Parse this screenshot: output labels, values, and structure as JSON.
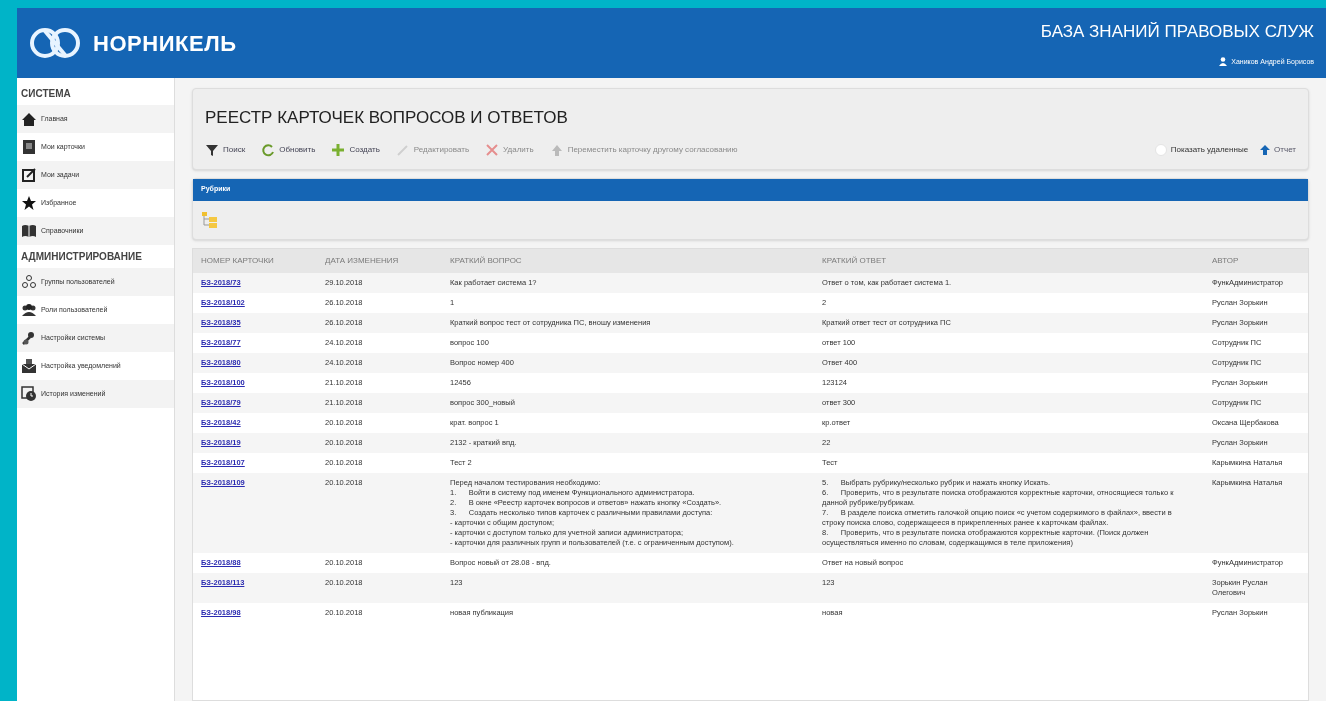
{
  "header": {
    "logo": "НОРНИКЕЛЬ",
    "title": "БАЗА ЗНАНИЙ ПРАВОВЫХ СЛУЖ",
    "user": "Хаников Андрей Борисов"
  },
  "sidebar": {
    "sections": [
      {
        "title": "СИСТЕМА",
        "items": [
          {
            "label": "Главная",
            "kind": "home"
          },
          {
            "label": "Мои карточки",
            "kind": "cards"
          },
          {
            "label": "Мои задачи",
            "kind": "tasks"
          },
          {
            "label": "Избранное",
            "kind": "star"
          },
          {
            "label": "Справочники",
            "kind": "book"
          }
        ]
      },
      {
        "title": "АДМИНИСТРИРОВАНИЕ",
        "items": [
          {
            "label": "Группы пользователей",
            "kind": "groups"
          },
          {
            "label": "Роли пользователей",
            "kind": "roles"
          },
          {
            "label": "Настройки системы",
            "kind": "settings"
          },
          {
            "label": "Настройка уведомлений",
            "kind": "notify"
          },
          {
            "label": "История изменений",
            "kind": "history"
          }
        ]
      }
    ]
  },
  "page_title": "РЕЕСТР КАРТОЧЕК ВОПРОСОВ И ОТВЕТОВ",
  "toolbar": [
    {
      "label": "Поиск",
      "kind": "filter",
      "disabled": false
    },
    {
      "label": "Обновить",
      "kind": "refresh",
      "disabled": false
    },
    {
      "label": "Создать",
      "kind": "plus",
      "disabled": false
    },
    {
      "label": "Редактировать",
      "kind": "edit",
      "disabled": true
    },
    {
      "label": "Удалить",
      "kind": "delete",
      "disabled": true
    },
    {
      "label": "Переместить карточку другому согласованию",
      "kind": "move",
      "disabled": true
    }
  ],
  "show_deleted": {
    "label": "Показать удаленные",
    "checked": false
  },
  "report": {
    "label": "Отчет"
  },
  "rubrics": {
    "title": "Рубрики"
  },
  "table": {
    "columns": [
      "НОМЕР КАРТОЧКИ",
      "ДАТА ИЗМЕНЕНИЯ",
      "КРАТКИЙ ВОПРОС",
      "КРАТКИЙ ОТВЕТ",
      "АВТОР"
    ],
    "rows": [
      [
        "БЗ-2018/73",
        "29.10.2018",
        "Как работает система 1?",
        "Ответ о том, как работает система 1.",
        "ФункАдминистратор"
      ],
      [
        "БЗ-2018/102",
        "26.10.2018",
        "1",
        "2",
        "Руслан Зорькин"
      ],
      [
        "БЗ-2018/35",
        "26.10.2018",
        "Краткий вопрос тест от сотрудника ПС, вношу изменения",
        "Краткий ответ тест от сотрудника ПС",
        "Руслан Зорькин"
      ],
      [
        "БЗ-2018/77",
        "24.10.2018",
        "вопрос 100",
        "ответ 100",
        "Сотрудник ПС"
      ],
      [
        "БЗ-2018/80",
        "24.10.2018",
        "Вопрос номер 400",
        "Ответ 400",
        "Сотрудник ПС"
      ],
      [
        "БЗ-2018/100",
        "21.10.2018",
        "12456",
        "123124",
        "Руслан Зорькин"
      ],
      [
        "БЗ-2018/79",
        "21.10.2018",
        "вопрос 300_новый",
        "ответ 300",
        "Сотрудник ПС"
      ],
      [
        "БЗ-2018/42",
        "20.10.2018",
        "крат. вопрос 1",
        "кр.ответ",
        "Оксана Щербакова"
      ],
      [
        "БЗ-2018/19",
        "20.10.2018",
        "2132 - краткий впд.",
        "22",
        "Руслан Зорькин"
      ],
      [
        "БЗ-2018/107",
        "20.10.2018",
        "Тест 2",
        "Тест",
        "Карымкина Наталья"
      ],
      [
        "БЗ-2018/109",
        "20.10.2018",
        "Перед началом тестирования необходимо:\n1.      Войти в систему под именем Функционального администратора.\n2.      В окне «Реестр карточек вопросов и ответов» нажать кнопку «Создать».\n3.      Создать несколько типов карточек с различными правилами доступа:\n- карточки с общим доступом;\n- карточки с доступом только для учетной записи администратора;\n- карточки для различных групп и пользователей (т.е. с ограниченным доступом).",
        "5.      Выбрать рубрику/несколько рубрик и нажать кнопку Искать.\n6.      Проверить, что в результате поиска отображаются корректные карточки, относящиеся только к данной рубрике/рубрикам.\n7.      В разделе поиска отметить галочкой опцию поиск «с учетом содержимого в файлах», ввести в строку поиска слово, содержащееся в прикрепленных ранее к карточкам файлах.\n8.      Проверить, что в результате поиска отображаются корректные карточки. (Поиск должен осуществляться именно по словам, содержащимся в теле приложения)",
        "Карымкина Наталья"
      ],
      [
        "БЗ-2018/88",
        "20.10.2018",
        "Вопрос новый от 28.08 - впд.",
        "Ответ на новый вопрос",
        "ФункАдминистратор"
      ],
      [
        "БЗ-2018/113",
        "20.10.2018",
        "123",
        "123",
        "Зорькин Руслан Олегович"
      ],
      [
        "БЗ-2018/98",
        "20.10.2018",
        "новая публикация",
        "новая",
        "Руслан Зорькин"
      ]
    ]
  }
}
